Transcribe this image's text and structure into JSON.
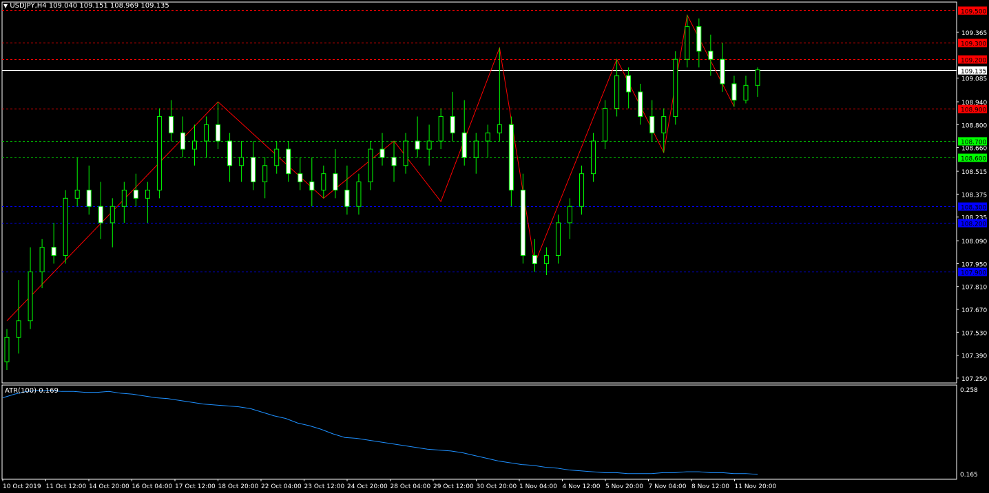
{
  "header": {
    "menu_triangle": "triangle-down-icon",
    "text": "USDJPY,H4  109.040 109.151 108.969 109.135"
  },
  "indicator": {
    "label": "ATR(100) 0.169",
    "axis_top": "0.258",
    "axis_bottom": "0.165",
    "line_color": "#1E90FF"
  },
  "colors": {
    "background": "#000000",
    "frame": "#FFFFFF",
    "bull": "#00FF00",
    "bear_body": "#FFFFFF",
    "zigzag": "#FF0000",
    "resistance": "#FF0000",
    "support_green": "#00C800",
    "support_blue": "#0000FF",
    "current_price": "#FFFFFF"
  },
  "price_axis": [
    "109.365",
    "109.085",
    "108.940",
    "108.800",
    "108.660",
    "108.515",
    "108.375",
    "108.235",
    "108.090",
    "107.950",
    "107.810",
    "107.670",
    "107.530",
    "107.390",
    "107.250"
  ],
  "levels": [
    {
      "price": 109.5,
      "label": "109.500",
      "color": "#FF0000",
      "label_bg": "#FF0000",
      "label_fg": "#000000",
      "dash": true
    },
    {
      "price": 109.3,
      "label": "109.300",
      "color": "#FF0000",
      "label_bg": "#FF0000",
      "label_fg": "#000000",
      "dash": true
    },
    {
      "price": 109.2,
      "label": "109.200",
      "color": "#FF0000",
      "label_bg": "#FF0000",
      "label_fg": "#000000",
      "dash": true
    },
    {
      "price": 108.9,
      "label": "108.900",
      "color": "#FF0000",
      "label_bg": "#FF0000",
      "label_fg": "#000000",
      "dash": true
    },
    {
      "price": 108.7,
      "label": "108.700",
      "color": "#00C800",
      "label_bg": "#00FF00",
      "label_fg": "#000000",
      "dash": true
    },
    {
      "price": 108.6,
      "label": "108.600",
      "color": "#00C800",
      "label_bg": "#00FF00",
      "label_fg": "#000000",
      "dash": true
    },
    {
      "price": 108.3,
      "label": "108.300",
      "color": "#0000FF",
      "label_bg": "#0000FF",
      "label_fg": "#000000",
      "dash": true
    },
    {
      "price": 108.2,
      "label": "108.200",
      "color": "#0000FF",
      "label_bg": "#0000FF",
      "label_fg": "#000000",
      "dash": true
    },
    {
      "price": 107.9,
      "label": "107.900",
      "color": "#0000FF",
      "label_bg": "#0000FF",
      "label_fg": "#000000",
      "dash": true
    }
  ],
  "current_price": {
    "price": 109.135,
    "label": "109.135"
  },
  "time_axis": [
    "10 Oct 2019",
    "11 Oct 12:00",
    "14 Oct 20:00",
    "16 Oct 04:00",
    "17 Oct 12:00",
    "18 Oct 20:00",
    "22 Oct 04:00",
    "23 Oct 12:00",
    "24 Oct 20:00",
    "28 Oct 04:00",
    "29 Oct 12:00",
    "30 Oct 20:00",
    "1 Nov 04:00",
    "4 Nov 12:00",
    "5 Nov 20:00",
    "7 Nov 04:00",
    "8 Nov 12:00",
    "11 Nov 20:00"
  ],
  "chart_data": {
    "type": "candlestick",
    "symbol": "USDJPY",
    "timeframe": "H4",
    "y_range": [
      107.25,
      109.5
    ],
    "zigzag": [
      107.6,
      108.94,
      108.35,
      108.7,
      108.33,
      109.27,
      107.95,
      109.2,
      108.63,
      109.47,
      108.91
    ],
    "candles": [
      [
        107.35,
        107.55,
        107.3,
        107.5
      ],
      [
        107.5,
        107.85,
        107.4,
        107.6
      ],
      [
        107.6,
        108.05,
        107.55,
        107.9
      ],
      [
        107.9,
        108.1,
        107.8,
        108.05
      ],
      [
        108.05,
        108.2,
        107.95,
        108.0
      ],
      [
        108.0,
        108.4,
        107.95,
        108.35
      ],
      [
        108.35,
        108.6,
        108.3,
        108.4
      ],
      [
        108.4,
        108.55,
        108.25,
        108.3
      ],
      [
        108.3,
        108.45,
        108.1,
        108.2
      ],
      [
        108.2,
        108.35,
        108.05,
        108.3
      ],
      [
        108.3,
        108.45,
        108.2,
        108.4
      ],
      [
        108.4,
        108.5,
        108.3,
        108.35
      ],
      [
        108.35,
        108.45,
        108.2,
        108.4
      ],
      [
        108.4,
        108.9,
        108.35,
        108.85
      ],
      [
        108.85,
        108.95,
        108.7,
        108.75
      ],
      [
        108.75,
        108.85,
        108.6,
        108.65
      ],
      [
        108.65,
        108.8,
        108.55,
        108.7
      ],
      [
        108.7,
        108.85,
        108.6,
        108.8
      ],
      [
        108.8,
        108.94,
        108.65,
        108.7
      ],
      [
        108.7,
        108.75,
        108.45,
        108.55
      ],
      [
        108.55,
        108.7,
        108.45,
        108.6
      ],
      [
        108.6,
        108.7,
        108.4,
        108.45
      ],
      [
        108.45,
        108.6,
        108.35,
        108.55
      ],
      [
        108.55,
        108.7,
        108.5,
        108.65
      ],
      [
        108.65,
        108.7,
        108.45,
        108.5
      ],
      [
        108.5,
        108.6,
        108.4,
        108.45
      ],
      [
        108.45,
        108.6,
        108.3,
        108.4
      ],
      [
        108.4,
        108.55,
        108.35,
        108.5
      ],
      [
        108.5,
        108.65,
        108.35,
        108.4
      ],
      [
        108.4,
        108.55,
        108.25,
        108.3
      ],
      [
        108.3,
        108.5,
        108.25,
        108.45
      ],
      [
        108.45,
        108.7,
        108.4,
        108.65
      ],
      [
        108.65,
        108.75,
        108.55,
        108.6
      ],
      [
        108.6,
        108.7,
        108.45,
        108.55
      ],
      [
        108.55,
        108.75,
        108.5,
        108.7
      ],
      [
        108.7,
        108.85,
        108.6,
        108.65
      ],
      [
        108.65,
        108.8,
        108.55,
        108.7
      ],
      [
        108.7,
        108.9,
        108.65,
        108.85
      ],
      [
        108.85,
        109.0,
        108.7,
        108.75
      ],
      [
        108.75,
        108.95,
        108.55,
        108.6
      ],
      [
        108.6,
        108.75,
        108.5,
        108.7
      ],
      [
        108.7,
        108.8,
        108.6,
        108.75
      ],
      [
        108.75,
        109.27,
        108.7,
        108.8
      ],
      [
        108.8,
        108.85,
        108.3,
        108.4
      ],
      [
        108.4,
        108.5,
        107.95,
        108.0
      ],
      [
        108.0,
        108.1,
        107.9,
        107.95
      ],
      [
        107.95,
        108.05,
        107.88,
        108.0
      ],
      [
        108.0,
        108.25,
        107.95,
        108.2
      ],
      [
        108.2,
        108.35,
        108.1,
        108.3
      ],
      [
        108.3,
        108.55,
        108.25,
        108.5
      ],
      [
        108.5,
        108.75,
        108.45,
        108.7
      ],
      [
        108.7,
        108.95,
        108.65,
        108.9
      ],
      [
        108.9,
        109.2,
        108.85,
        109.1
      ],
      [
        109.1,
        109.15,
        108.9,
        109.0
      ],
      [
        109.0,
        109.05,
        108.8,
        108.85
      ],
      [
        108.85,
        108.95,
        108.7,
        108.75
      ],
      [
        108.75,
        108.9,
        108.63,
        108.85
      ],
      [
        108.85,
        109.25,
        108.8,
        109.2
      ],
      [
        109.2,
        109.47,
        109.15,
        109.4
      ],
      [
        109.4,
        109.45,
        109.15,
        109.25
      ],
      [
        109.25,
        109.35,
        109.1,
        109.2
      ],
      [
        109.2,
        109.3,
        109.0,
        109.05
      ],
      [
        109.05,
        109.1,
        108.91,
        108.95
      ],
      [
        108.95,
        109.1,
        108.93,
        109.04
      ],
      [
        109.04,
        109.15,
        108.97,
        109.135
      ]
    ],
    "atr_values": [
      0.25,
      0.254,
      0.257,
      0.258,
      0.258,
      0.257,
      0.257,
      0.256,
      0.256,
      0.257,
      0.255,
      0.254,
      0.252,
      0.25,
      0.249,
      0.247,
      0.245,
      0.243,
      0.242,
      0.241,
      0.24,
      0.238,
      0.234,
      0.23,
      0.227,
      0.222,
      0.219,
      0.215,
      0.21,
      0.206,
      0.205,
      0.203,
      0.201,
      0.199,
      0.197,
      0.195,
      0.193,
      0.192,
      0.191,
      0.189,
      0.186,
      0.183,
      0.18,
      0.178,
      0.176,
      0.175,
      0.173,
      0.172,
      0.17,
      0.169,
      0.168,
      0.167,
      0.167,
      0.166,
      0.166,
      0.166,
      0.167,
      0.167,
      0.168,
      0.168,
      0.167,
      0.167,
      0.166,
      0.166,
      0.165
    ]
  }
}
